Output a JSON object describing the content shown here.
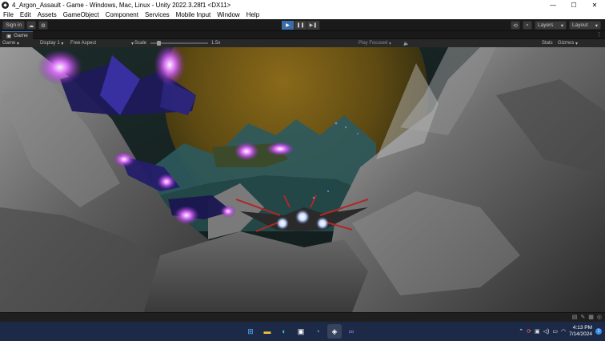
{
  "window": {
    "title": "4_Argon_Assault - Game - Windows, Mac, Linux - Unity 2022.3.28f1 <DX11>",
    "minimize": "—",
    "maximize": "☐",
    "close": "✕"
  },
  "menu": [
    "File",
    "Edit",
    "Assets",
    "GameObject",
    "Component",
    "Services",
    "Mobile Input",
    "Window",
    "Help"
  ],
  "toolbar": {
    "sign_in": "Sign in",
    "layers": "Layers",
    "layout": "Layout"
  },
  "game_tab": {
    "label": "Game",
    "more": "⋮"
  },
  "game_toolbar": {
    "mode": "Game",
    "display": "Display 1",
    "aspect": "Free Aspect",
    "scale_label": "Scale",
    "scale_value": "1.5x",
    "scale_fraction": 0.15,
    "play_focused": "Play Focused",
    "stats": "Stats",
    "gizmos": "Gizmos"
  },
  "taskbar": {
    "time": "4:13 PM",
    "date": "7/14/2024",
    "notifications": "1",
    "apps": [
      "windows-start",
      "file-explorer",
      "edge",
      "store",
      "chrome",
      "unity",
      "visual-studio"
    ]
  },
  "colors": {
    "editor_bg": "#1e1e1e",
    "play_active": "#3b6ea8",
    "taskbar": "#1c2a47",
    "engine_glow": "#d24dff"
  }
}
